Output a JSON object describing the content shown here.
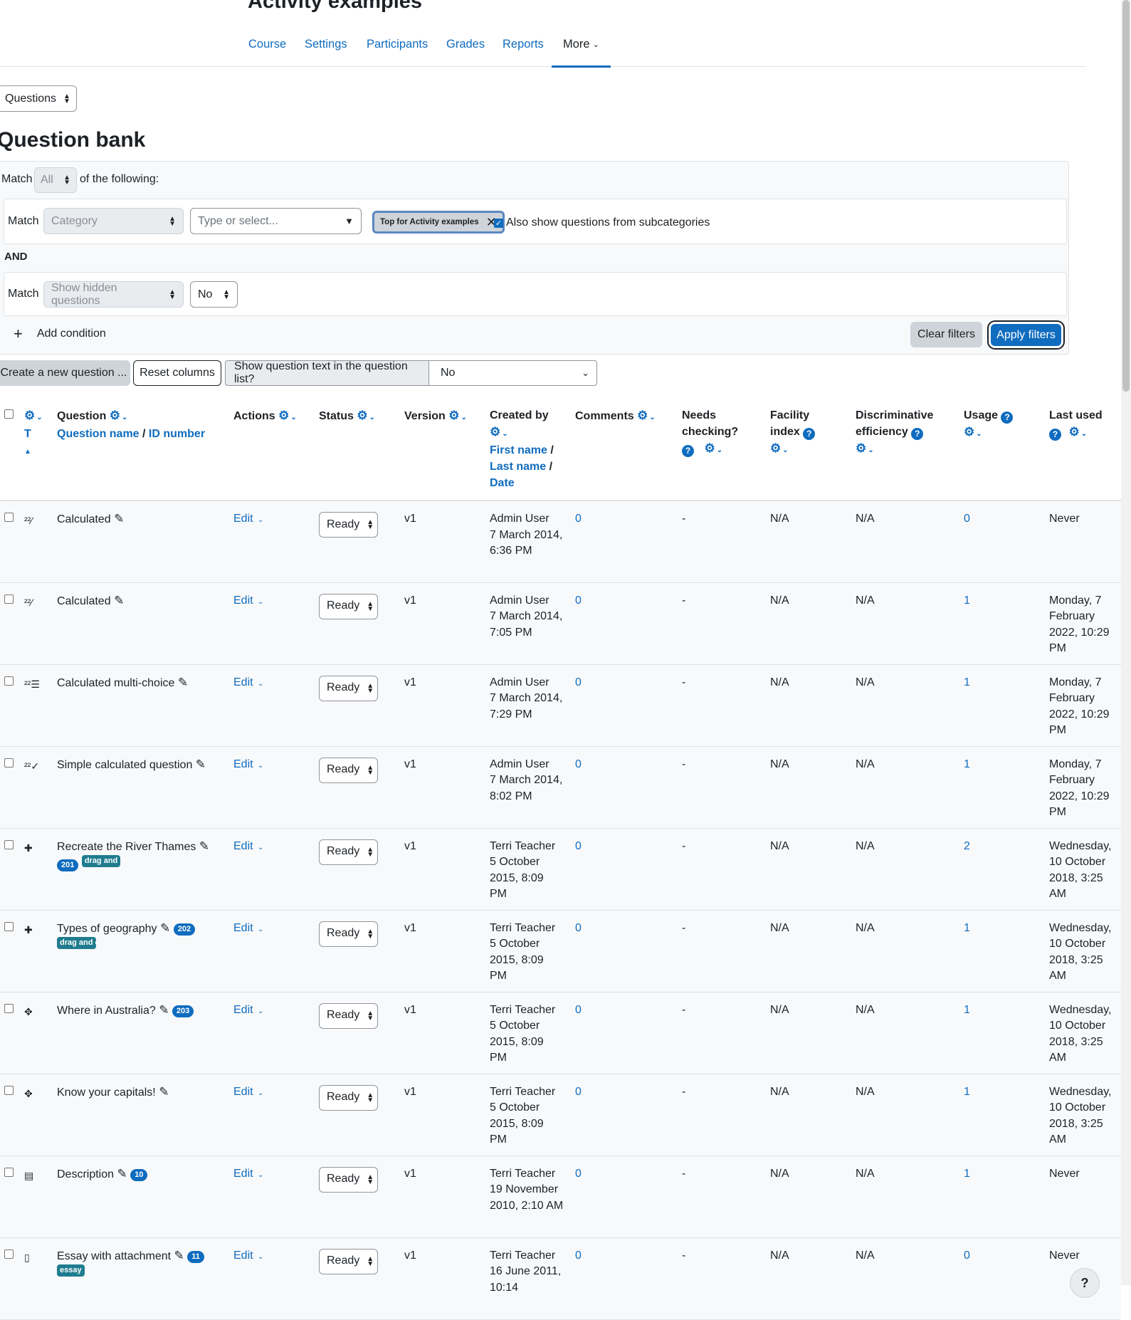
{
  "page": {
    "title": "Activity examples"
  },
  "nav": {
    "items": [
      "Course",
      "Settings",
      "Participants",
      "Grades",
      "Reports"
    ],
    "more": "More"
  },
  "jump": {
    "value": "Questions"
  },
  "bank": {
    "title": "Question bank"
  },
  "filters": {
    "match_label": "Match",
    "match_value": "All",
    "of_following": "of the following:",
    "cond1": {
      "match": "Match",
      "type": "Category",
      "input_placeholder": "Type or select...",
      "tag": "Top for Activity examples",
      "subcat_label": "Also show questions from subcategories",
      "subcat_checked": true
    },
    "and_label": "AND",
    "cond2": {
      "match": "Match",
      "type": "Show hidden questions",
      "value": "No"
    },
    "add_condition": "Add condition",
    "clear": "Clear filters",
    "apply": "Apply filters"
  },
  "toolbar": {
    "create": "Create a new question ...",
    "reset": "Reset columns",
    "show_text_label": "Show question text in the question list?",
    "show_text_value": "No"
  },
  "columns": {
    "type_letter": "T",
    "question": "Question",
    "question_name": "Question name",
    "id_number": "ID number",
    "actions": "Actions",
    "status": "Status",
    "version": "Version",
    "created_by": "Created by",
    "first_name": "First name",
    "last_name": "Last name",
    "date": "Date",
    "comments": "Comments",
    "needs1": "Needs",
    "needs2": "checking?",
    "facility1": "Facility",
    "facility2": "index",
    "disc1": "Discriminative",
    "disc2": "efficiency",
    "usage": "Usage",
    "last_used": "Last used"
  },
  "rows": [
    {
      "name": "Calculated",
      "id": "",
      "tag": "",
      "icon": "calculated-icon",
      "action": "Edit",
      "status": "Ready",
      "version": "v1",
      "creator": "Admin User",
      "date": "7 March 2014, 6:36 PM",
      "comments": "0",
      "needs": "-",
      "facility": "N/A",
      "disc": "N/A",
      "usage": "0",
      "last_used": "Never"
    },
    {
      "name": "Calculated",
      "id": "",
      "tag": "",
      "icon": "calculated-icon",
      "action": "Edit",
      "status": "Ready",
      "version": "v1",
      "creator": "Admin User",
      "date": "7 March 2014, 7:05 PM",
      "comments": "0",
      "needs": "-",
      "facility": "N/A",
      "disc": "N/A",
      "usage": "1",
      "last_used": "Monday, 7 February 2022, 10:29 PM"
    },
    {
      "name": "Calculated multi-choice",
      "id": "",
      "tag": "",
      "icon": "calculated-multi-icon",
      "action": "Edit",
      "status": "Ready",
      "version": "v1",
      "creator": "Admin User",
      "date": "7 March 2014, 7:29 PM",
      "comments": "0",
      "needs": "-",
      "facility": "N/A",
      "disc": "N/A",
      "usage": "1",
      "last_used": "Monday, 7 February 2022, 10:29 PM"
    },
    {
      "name": "Simple calculated question",
      "id": "",
      "tag": "",
      "icon": "calculated-simple-icon",
      "action": "Edit",
      "status": "Ready",
      "version": "v1",
      "creator": "Admin User",
      "date": "7 March 2014, 8:02 PM",
      "comments": "0",
      "needs": "-",
      "facility": "N/A",
      "disc": "N/A",
      "usage": "1",
      "last_used": "Monday, 7 February 2022, 10:29 PM"
    },
    {
      "name": "Recreate the River Thames",
      "id": "201",
      "tag": "drag and",
      "icon": "drag-drop-icon",
      "action": "Edit",
      "status": "Ready",
      "version": "v1",
      "creator": "Terri Teacher",
      "date": "5 October 2015, 8:09 PM",
      "comments": "0",
      "needs": "-",
      "facility": "N/A",
      "disc": "N/A",
      "usage": "2",
      "last_used": "Wednesday, 10 October 2018, 3:25 AM"
    },
    {
      "name": "Types of geography",
      "id": "202",
      "tag": "drag and dr",
      "icon": "drag-drop-icon",
      "action": "Edit",
      "status": "Ready",
      "version": "v1",
      "creator": "Terri Teacher",
      "date": "5 October 2015, 8:09 PM",
      "comments": "0",
      "needs": "-",
      "facility": "N/A",
      "disc": "N/A",
      "usage": "1",
      "last_used": "Wednesday, 10 October 2018, 3:25 AM"
    },
    {
      "name": "Where in Australia?",
      "id": "203",
      "tag": "",
      "icon": "drag-marker-icon",
      "action": "Edit",
      "status": "Ready",
      "version": "v1",
      "creator": "Terri Teacher",
      "date": "5 October 2015, 8:09 PM",
      "comments": "0",
      "needs": "-",
      "facility": "N/A",
      "disc": "N/A",
      "usage": "1",
      "last_used": "Wednesday, 10 October 2018, 3:25 AM"
    },
    {
      "name": "Know your capitals!",
      "id": "",
      "tag": "",
      "icon": "drag-marker-icon",
      "action": "Edit",
      "status": "Ready",
      "version": "v1",
      "creator": "Terri Teacher",
      "date": "5 October 2015, 8:09 PM",
      "comments": "0",
      "needs": "-",
      "facility": "N/A",
      "disc": "N/A",
      "usage": "1",
      "last_used": "Wednesday, 10 October 2018, 3:25 AM"
    },
    {
      "name": "Description",
      "id": "10",
      "tag": "",
      "icon": "description-icon",
      "action": "Edit",
      "status": "Ready",
      "version": "v1",
      "creator": "Terri Teacher",
      "date": "19 November 2010, 2:10 AM",
      "comments": "0",
      "needs": "-",
      "facility": "N/A",
      "disc": "N/A",
      "usage": "1",
      "last_used": "Never"
    },
    {
      "name": "Essay with attachment",
      "id": "11",
      "tag": "essay",
      "icon": "essay-icon",
      "action": "Edit",
      "status": "Ready",
      "version": "v1",
      "creator": "Terri Teacher",
      "date": "16 June 2011, 10:14",
      "comments": "0",
      "needs": "-",
      "facility": "N/A",
      "disc": "N/A",
      "usage": "0",
      "last_used": "Never"
    }
  ],
  "help_button": "?"
}
